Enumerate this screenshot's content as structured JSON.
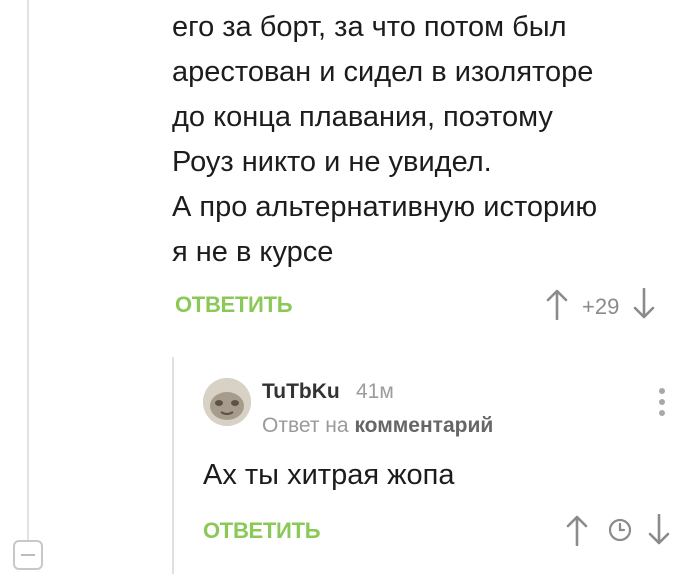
{
  "parent_comment": {
    "lines": [
      "его за борт, за что потом был",
      "арестован и сидел в изоляторе",
      "до конца плавания, поэтому",
      "Роуз никто и не увидел.",
      "А про альтернативную историю",
      "я не в курсе"
    ],
    "reply_label": "ОТВЕТИТЬ",
    "rating": "+29"
  },
  "reply_comment": {
    "username": "TuTbKu",
    "time": "41м",
    "reply_to_prefix": "Ответ на",
    "reply_to_target": "комментарий",
    "text": "Ах ты хитрая жопа",
    "reply_label": "ОТВЕТИТЬ"
  },
  "icons": {
    "upvote": "arrow-up-icon",
    "downvote": "arrow-down-icon",
    "clock": "clock-icon",
    "more": "more-vertical-icon",
    "collapse": "collapse-icon"
  },
  "colors": {
    "accent_green": "#8ac858",
    "thread_line": "#e3e3e3",
    "muted_text": "#9a9a9a"
  }
}
